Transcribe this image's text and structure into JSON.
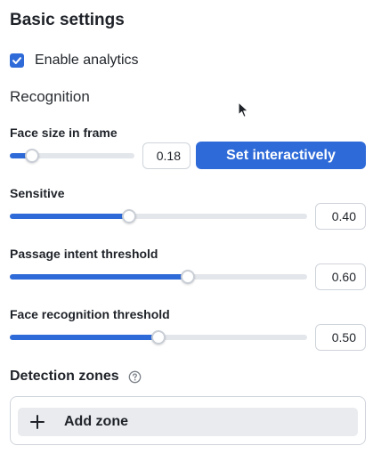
{
  "panel": {
    "title": "Basic settings",
    "analytics": {
      "label": "Enable analytics",
      "checked": true
    },
    "recognition_title": "Recognition"
  },
  "face_size": {
    "label": "Face size in frame",
    "value": "0.18",
    "fraction": 0.18,
    "button_label": "Set interactively"
  },
  "sliders": [
    {
      "label": "Sensitive",
      "value": "0.40",
      "fraction": 0.4
    },
    {
      "label": "Passage intent threshold",
      "value": "0.60",
      "fraction": 0.6
    },
    {
      "label": "Face recognition threshold",
      "value": "0.50",
      "fraction": 0.5
    }
  ],
  "detection": {
    "title": "Detection zones",
    "add_label": "Add zone"
  },
  "icons": {
    "checkbox": "check-icon",
    "help": "question-circle-icon",
    "add": "plus-icon",
    "cursor": "mouse-pointer-icon"
  },
  "colors": {
    "accent": "#2f6bd8",
    "track": "#e3e6ea",
    "button_bg": "#e9ebee"
  }
}
